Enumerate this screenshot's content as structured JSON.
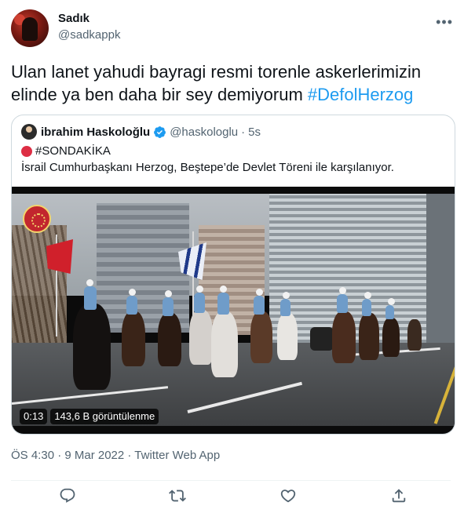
{
  "author": {
    "name": "Sadık",
    "handle": "@sadkappk",
    "avatar_icon": "profile-avatar",
    "more_icon": "more-options-icon"
  },
  "tweet": {
    "text_main": "Ulan lanet yahudi bayragi resmi torenle askerlerimizin elinde ya ben daha bir sey demiyorum ",
    "hashtag": "#DefolHerzog"
  },
  "quoted": {
    "name": "ibrahim Haskoloğlu",
    "handle": "@haskologlu",
    "separator": "·",
    "time": "5s",
    "line1": "#SONDAKİKA",
    "line2": "İsrail Cumhurbaşkanı Herzog, Beştepe’de Devlet Töreni ile karşılanıyor.",
    "verified_icon": "verified-badge-icon",
    "red_circle_icon": "red-circle-emoji",
    "video": {
      "duration": "0:13",
      "views": "143,6 B görüntülenme"
    }
  },
  "meta": {
    "timestamp": "ÖS 4:30 · 9 Mar 2022 · Twitter Web App"
  },
  "actions": [
    {
      "name": "reply",
      "icon": "reply-icon"
    },
    {
      "name": "retweet",
      "icon": "retweet-icon"
    },
    {
      "name": "like",
      "icon": "heart-icon"
    },
    {
      "name": "share",
      "icon": "share-icon"
    }
  ],
  "colors": {
    "accent": "#1d9bf0",
    "secondary_text": "#536471",
    "border": "#cfd9de"
  }
}
